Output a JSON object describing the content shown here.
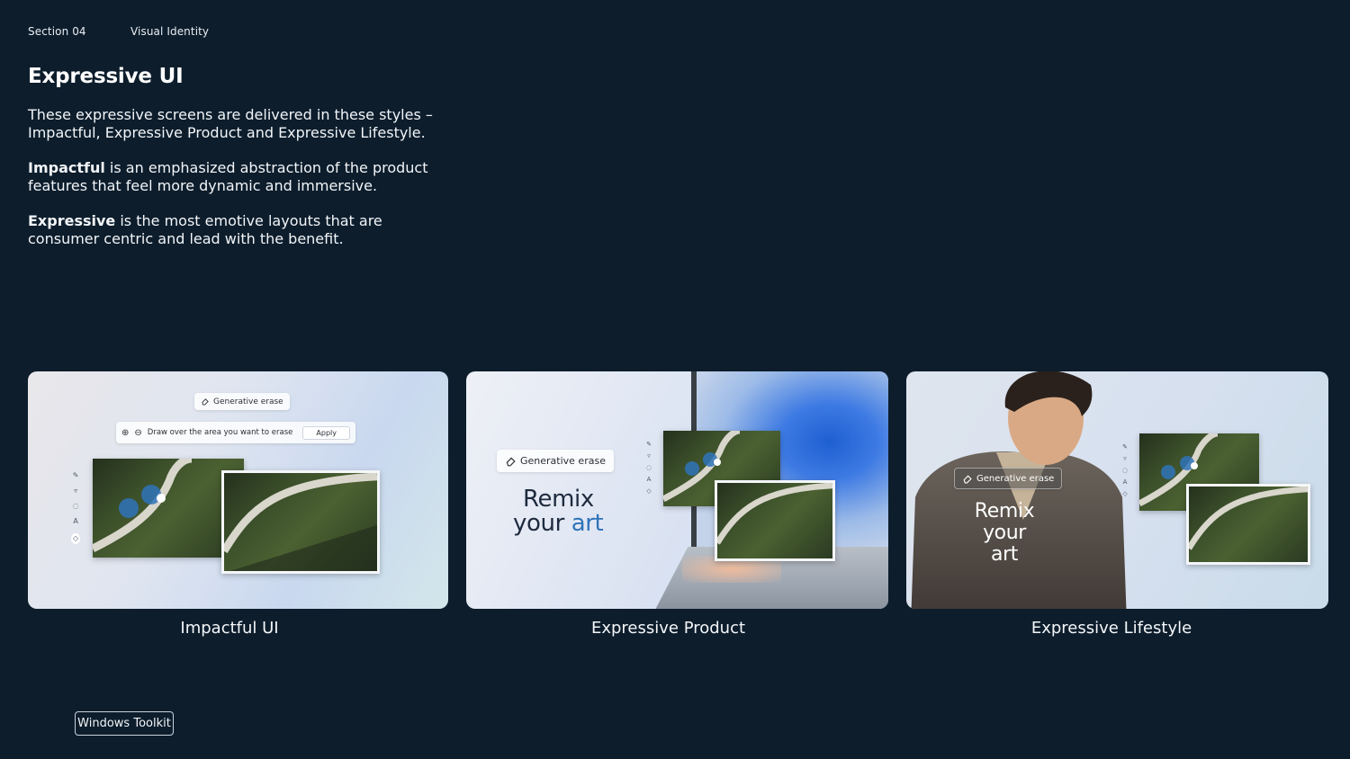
{
  "header": {
    "section": "Section 04",
    "topic": "Visual Identity"
  },
  "intro": {
    "title": "Expressive UI",
    "para1": "These expressive screens are delivered in these styles – Impactful, Expressive Product and Expressive Lifestyle.",
    "para2_bold": "Impactful",
    "para2_rest": " is an emphasized abstraction of the product features that feel more dynamic and immersive.",
    "para3_bold": "Expressive",
    "para3_rest": " is the most emotive layouts that are consumer centric and lead with the benefit."
  },
  "cards": [
    {
      "caption": "Impactful UI",
      "chip": "Generative erase",
      "instruction": "Draw over the area you want to erase",
      "apply": "Apply"
    },
    {
      "caption": "Expressive Product",
      "chip": "Generative erase",
      "headline_1": "Remix",
      "headline_2a": "your ",
      "headline_2b": "art"
    },
    {
      "caption": "Expressive Lifestyle",
      "chip": "Generative erase",
      "headline_1": "Remix",
      "headline_2": "your art"
    }
  ],
  "footer": {
    "toolkit_label": "Windows Toolkit"
  },
  "icons": [
    "eraser-icon",
    "zoom-in-icon",
    "zoom-out-icon",
    "pen-icon",
    "highlighter-icon",
    "lasso-icon",
    "text-icon"
  ],
  "colors": {
    "background": "#0d1d2c",
    "accent_blue": "#2f73b8",
    "text_light": "#f2f5f8"
  }
}
